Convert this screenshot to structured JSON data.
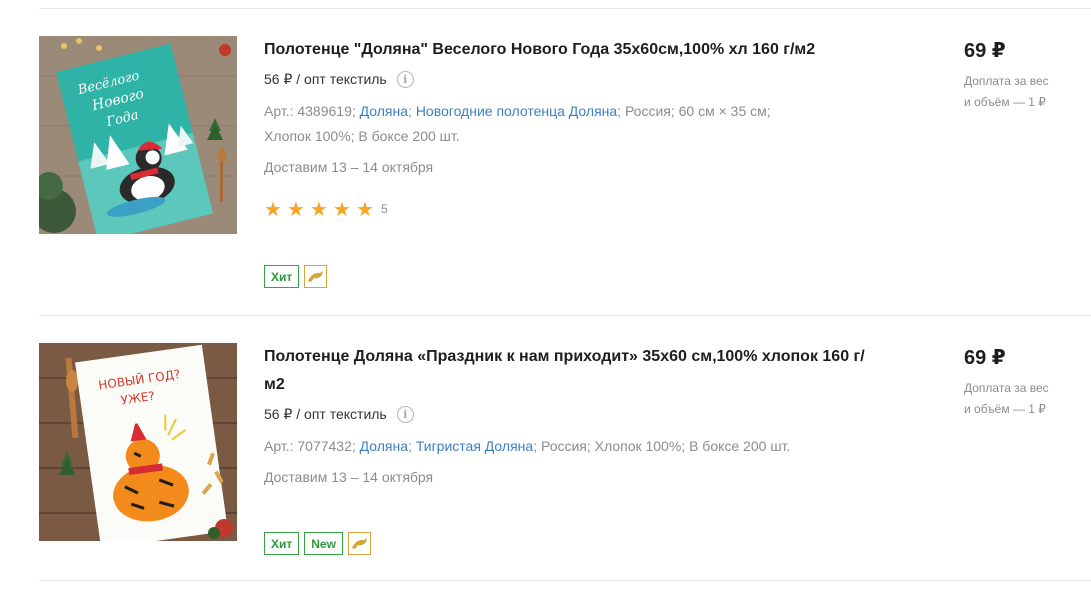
{
  "products": [
    {
      "title": "Полотенце \"Доляна\" Веселого Нового Года 35х60см,100% хл 160 г/м2",
      "wholesale": "56 ₽ / опт текстиль",
      "info_icon": "info-icon",
      "article": "Арт.: 4389619;",
      "brand_link": "Доляна",
      "collection_link": "Новогодние полотенца Доляна",
      "attrs_rest_line1": "; Россия; 60 см × 35 см;",
      "attrs_line2": "Хлопок 100%; В боксе 200 шт.",
      "delivery": "Доставим 13 – 14 октября",
      "rating": 5,
      "rating_count": "5",
      "badges": [
        "Хит"
      ],
      "price": "69 ₽",
      "price_note_1": "Доплата за вес",
      "price_note_2": "и объём — 1 ₽"
    },
    {
      "title": "Полотенце Доляна «Праздник к нам приходит» 35х60 см,100% хлопок 160 г/м2",
      "wholesale": "56 ₽ / опт текстиль",
      "info_icon": "info-icon",
      "article": "Арт.: 7077432;",
      "brand_link": "Доляна",
      "collection_link": "Тигристая Доляна",
      "attrs_rest_line1": "; Россия; Хлопок 100%; В боксе 200 шт.",
      "delivery": "Доставим 13 – 14 октября",
      "badges": [
        "Хит",
        "New"
      ],
      "price": "69 ₽",
      "price_note_1": "Доплата за вес",
      "price_note_2": "и объём — 1 ₽"
    }
  ],
  "colors": {
    "link": "#3c7fc4",
    "badge_green": "#35a447",
    "star": "#f5a623",
    "badge_icon_border": "#d9a53a"
  }
}
